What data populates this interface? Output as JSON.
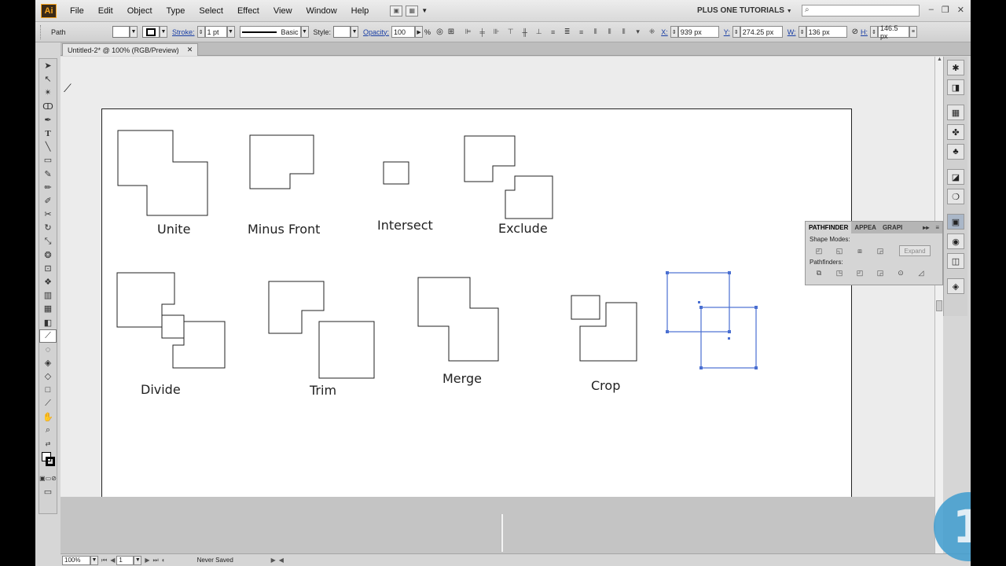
{
  "app": {
    "logo_text": "Ai",
    "menu": [
      "File",
      "Edit",
      "Object",
      "Type",
      "Select",
      "Effect",
      "View",
      "Window",
      "Help"
    ],
    "workspace": "PLUS ONE TUTORIALS",
    "window_controls": [
      "–",
      "❐",
      "✕"
    ]
  },
  "control": {
    "selection_type": "Path",
    "stroke_label": "Stroke:",
    "stroke_value": "1 pt",
    "brush": "Basic",
    "style_label": "Style:",
    "opacity_label": "Opacity:",
    "opacity_value": "100",
    "opacity_unit": "%",
    "x_label": "X:",
    "x_value": "939 px",
    "y_label": "Y:",
    "y_value": "274.25 px",
    "w_label": "W:",
    "w_value": "136 px",
    "h_label": "H:",
    "h_value": "146.5 px"
  },
  "document": {
    "tab_title": "Untitled-2* @ 100% (RGB/Preview)",
    "tab_close": "✕"
  },
  "labels": {
    "unite": "Unite",
    "minus_front": "Minus Front",
    "intersect": "Intersect",
    "exclude": "Exclude",
    "divide": "Divide",
    "trim": "Trim",
    "merge": "Merge",
    "crop": "Crop"
  },
  "pathfinder": {
    "tabs": [
      "PATHFINDER",
      "APPEA",
      "GRAPI"
    ],
    "shape_modes_label": "Shape Modes:",
    "expand_label": "Expand",
    "pathfinders_label": "Pathfinders:"
  },
  "status": {
    "zoom": "100%",
    "artboard": "1",
    "save_state": "Never Saved"
  },
  "watermark": "1",
  "colors": {
    "selection_blue": "#4a6fd1",
    "accent_link": "#1a3fa5"
  }
}
